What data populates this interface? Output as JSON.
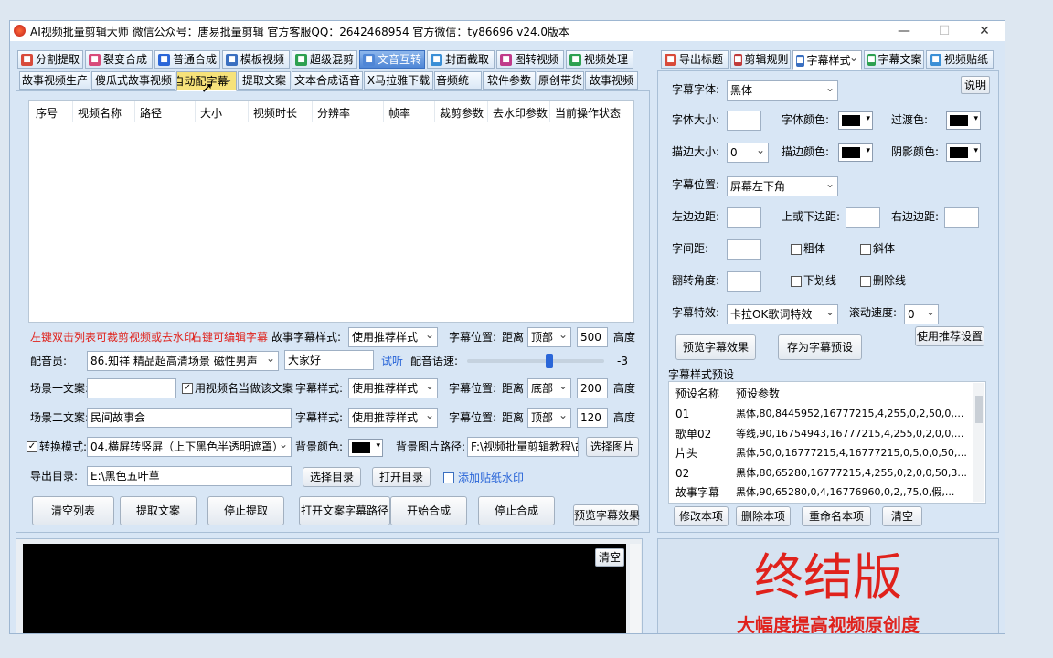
{
  "window": {
    "title": "AI视频批量剪辑大师    微信公众号：唐易批量剪辑    官方客服QQ：2642468954    官方微信：ty86696    v24.0版本",
    "minimize": "—",
    "maximize": "☐",
    "close": "✕"
  },
  "top_tabs": [
    {
      "label": "分割提取",
      "icon": "scissors-icon",
      "color": "#d84a3a"
    },
    {
      "label": "裂变合成",
      "icon": "split-icon",
      "color": "#d84a7a"
    },
    {
      "label": "普通合成",
      "icon": "play-icon",
      "color": "#2a66d8"
    },
    {
      "label": "模板视频",
      "icon": "template-icon",
      "color": "#3a6fc0"
    },
    {
      "label": "超级混剪",
      "icon": "bars-icon",
      "color": "#2da050"
    },
    {
      "label": "文音互转",
      "icon": "audio-icon",
      "color": "#4f86d6"
    },
    {
      "label": "封面截取",
      "icon": "image-icon",
      "color": "#3a8fd6"
    },
    {
      "label": "图转视频",
      "icon": "photo-icon",
      "color": "#c03a8a"
    },
    {
      "label": "视频处理",
      "icon": "video-icon",
      "color": "#2da050"
    }
  ],
  "sub_tabs": [
    "故事视频生产",
    "傻瓜式故事视频",
    "自动配字幕",
    "提取文案",
    "文本合成语音",
    "X马拉雅下载",
    "音频统一",
    "软件参数",
    "原创带货",
    "故事视频"
  ],
  "table": {
    "headers": [
      "序号",
      "视频名称",
      "路径",
      "大小",
      "视频时长",
      "分辨率",
      "帧率",
      "裁剪参数",
      "去水印参数",
      "当前操作状态"
    ]
  },
  "left_form": {
    "hint1": "左键双击列表可裁剪视频或去水印",
    "hint2": "右键可编辑字幕",
    "story_style_label": "故事字幕样式:",
    "story_style_value": "使用推荐样式",
    "pos_label": "字幕位置:",
    "dist_label": "距离",
    "row1_pos": "顶部",
    "row1_num": "500",
    "height_label": "高度",
    "voice_label": "配音员:",
    "voice_value": "86.知祥 精品超高清场景 磁性男声",
    "voice_text": "大家好",
    "listen": "试听",
    "speed_label": "配音语速:",
    "speed_value": "-3",
    "speed_fraction": 0.6,
    "scene1_label": "场景一文案:",
    "use_name_label": "用视频名当做该文案",
    "style_label": "字幕样式:",
    "style_value": "使用推荐样式",
    "row3_pos": "底部",
    "row3_num": "200",
    "scene2_label": "场景二文案:",
    "scene2_value": "民间故事会",
    "row4_pos": "顶部",
    "row4_num": "120",
    "convert_label": "转换模式:",
    "convert_value": "04.横屏转竖屏（上下黑色半透明遮罩）",
    "bg_color_label": "背景颜色:",
    "bg_img_label": "背景图片路径:",
    "bg_img_value": "F:\\视频批量剪辑教程\\故",
    "choose_img": "选择图片",
    "export_label": "导出目录:",
    "export_value": "E:\\黑色五叶草",
    "choose_dir": "选择目录",
    "open_dir": "打开目录",
    "watermark_link": "添加贴纸水印"
  },
  "buttons": [
    "清空列表",
    "提取文案",
    "停止提取",
    "打开文案字幕路径",
    "开始合成",
    "停止合成",
    "预览字幕效果"
  ],
  "log": {
    "clear": "清空"
  },
  "right_tabs": [
    {
      "label": "导出标题",
      "icon": "export-icon",
      "color": "#d84a3a"
    },
    {
      "label": "剪辑规则",
      "icon": "rule-icon",
      "color": "#c03a3a"
    },
    {
      "label": "字幕样式",
      "icon": "subtitle-icon",
      "color": "#3a6fc0"
    },
    {
      "label": "字幕文案",
      "icon": "doc-icon",
      "color": "#2da050"
    },
    {
      "label": "视频贴纸",
      "icon": "star-icon",
      "color": "#3a8fd6"
    }
  ],
  "right_form": {
    "font_label": "字幕字体:",
    "font_value": "黑体",
    "help": "说明",
    "size_label": "字体大小:",
    "color_label": "字体颜色:",
    "trans_label": "过渡色:",
    "stroke_label": "描边大小:",
    "stroke_value": "0",
    "stroke_color_label": "描边颜色:",
    "shadow_label": "阴影颜色:",
    "pos_label": "字幕位置:",
    "pos_value": "屏幕左下角",
    "left_margin": "左边边距:",
    "top_margin": "上或下边距:",
    "right_margin": "右边边距:",
    "spacing": "字间距:",
    "bold": "粗体",
    "italic": "斜体",
    "rotate": "翻转角度:",
    "underline": "下划线",
    "strike": "删除线",
    "effect_label": "字幕特效:",
    "effect_value": "卡拉OK歌词特效",
    "scroll_label": "滚动速度:",
    "scroll_value": "0",
    "use_recommended": "使用推荐设置",
    "preview": "预览字幕效果",
    "save_preset": "存为字幕预设",
    "preset_title": "字幕样式预设",
    "preset_headers": [
      "预设名称",
      "预设参数"
    ],
    "presets": [
      [
        "01",
        "黑体,80,8445952,16777215,4,255,0,2,50,0,..."
      ],
      [
        "歌单02",
        "等线,90,16754943,16777215,4,255,0,2,0,0,..."
      ],
      [
        "片头",
        "黑体,50,0,16777215,4,16777215,0,5,0,0,50,..."
      ],
      [
        "02",
        "黑体,80,65280,16777215,4,255,0,2,0,0,50,3..."
      ],
      [
        "故事字幕",
        "黑体,90,65280,0,4,16776960,0,2,,75,0,假,..."
      ]
    ],
    "preset_buttons": [
      "修改本项",
      "删除本项",
      "重命名本项",
      "清空"
    ]
  },
  "promo": {
    "title": "终结版",
    "subtitle": "大幅度提高视频原创度"
  },
  "colors": {
    "accent": "#4f86d6",
    "promo_red": "#e0221c",
    "window_bg": "#d8e6f5"
  }
}
